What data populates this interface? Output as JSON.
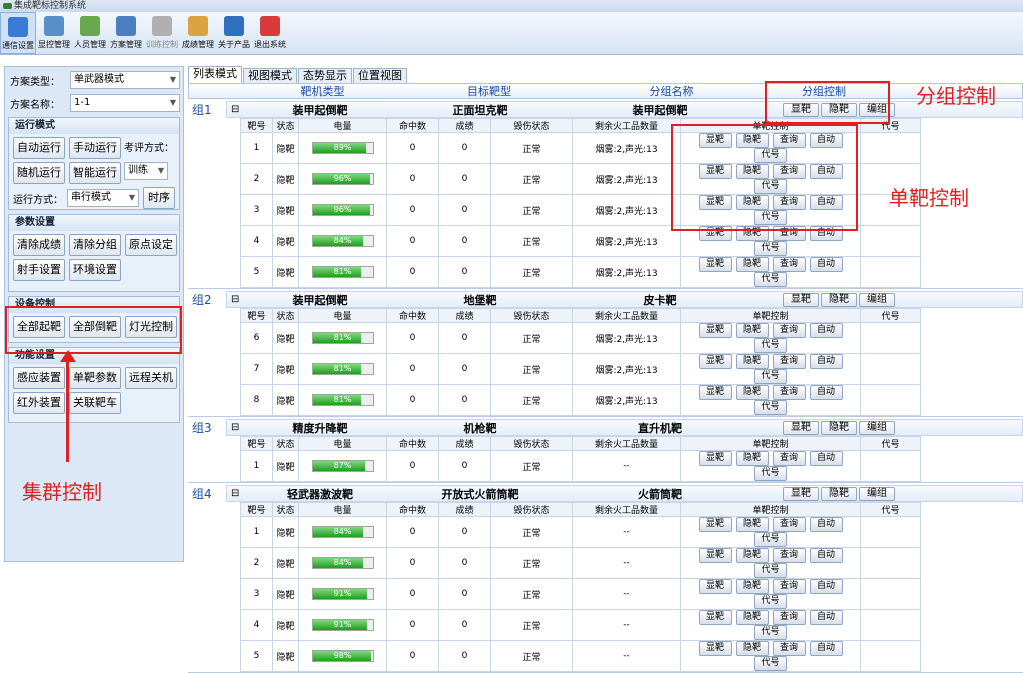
{
  "window_title": "集成靶标控制系统",
  "toolbar": [
    {
      "label": "通信设置",
      "color": "#3a7bd5",
      "active": true
    },
    {
      "label": "显控管理",
      "color": "#5b8fc9"
    },
    {
      "label": "人员管理",
      "color": "#6aa84f"
    },
    {
      "label": "方案管理",
      "color": "#4a7fc1"
    },
    {
      "label": "训练控制",
      "color": "#b0b0b0",
      "disabled": true
    },
    {
      "label": "成绩管理",
      "color": "#d9a441"
    },
    {
      "label": "关于产品",
      "color": "#2f6fbf"
    },
    {
      "label": "退出系统",
      "color": "#d93a3a"
    }
  ],
  "left": {
    "scheme_type_label": "方案类型：",
    "scheme_type_value": "单武器模式",
    "scheme_name_label": "方案名称：",
    "scheme_name_value": "1-1",
    "run_mode_title": "运行模式",
    "auto_run": "自动运行",
    "manual_run": "手动运行",
    "eval_mode_label": "考评方式：",
    "eval_mode_value": "训练",
    "random_run": "随机运行",
    "smart_run": "智能运行",
    "run_way_label": "运行方式：",
    "run_way_value": "串行模式",
    "timing": "时序",
    "param_title": "参数设置",
    "clear_scores": "清除成绩",
    "clear_groups": "清除分组",
    "origin_set": "原点设定",
    "shooter_set": "射手设置",
    "env_set": "环境设置",
    "device_title": "设备控制",
    "all_up": "全部起靶",
    "all_down": "全部倒靶",
    "light_ctrl": "灯光控制",
    "func_title": "功能设置",
    "sensor": "感应装置",
    "single_param": "单靶参数",
    "remote_off": "远程关机",
    "infrared": "红外装置",
    "link_car": "关联靶车"
  },
  "tabs": [
    "列表模式",
    "视图模式",
    "态势显示",
    "位置视图"
  ],
  "header": {
    "type": "靶机类型",
    "target": "目标靶型",
    "group_name": "分组名称",
    "group_ctrl": "分组控制"
  },
  "cols": [
    "靶号",
    "状态",
    "电量",
    "命中数",
    "成绩",
    "毁伤状态",
    "剩余火工品数量",
    "单靶控制",
    "代号"
  ],
  "ctrl_buttons": [
    "显靶",
    "隐靶",
    "查询",
    "自动",
    "代号"
  ],
  "group_buttons": [
    "显靶",
    "隐靶",
    "编组"
  ],
  "groups": [
    {
      "label": "组1",
      "names": [
        "装甲起倒靶",
        "正面坦克靶",
        "装甲起倒靶"
      ],
      "rows": [
        {
          "no": "1",
          "status": "隐靶",
          "battery": 89,
          "bat_text": "89%",
          "hits": "0",
          "score": "0",
          "damage": "正常",
          "remain": "烟雾:2,声光:13"
        },
        {
          "no": "2",
          "status": "隐靶",
          "battery": 96,
          "bat_text": "96%",
          "hits": "0",
          "score": "0",
          "damage": "正常",
          "remain": "烟雾:2,声光:13"
        },
        {
          "no": "3",
          "status": "隐靶",
          "battery": 96,
          "bat_text": "96%",
          "hits": "0",
          "score": "0",
          "damage": "正常",
          "remain": "烟雾:2,声光:13"
        },
        {
          "no": "4",
          "status": "隐靶",
          "battery": 84,
          "bat_text": "84%",
          "hits": "0",
          "score": "0",
          "damage": "正常",
          "remain": "烟雾:2,声光:13"
        },
        {
          "no": "5",
          "status": "隐靶",
          "battery": 81,
          "bat_text": "81%",
          "hits": "0",
          "score": "0",
          "damage": "正常",
          "remain": "烟雾:2,声光:13"
        }
      ]
    },
    {
      "label": "组2",
      "names": [
        "装甲起倒靶",
        "地堡靶",
        "皮卡靶"
      ],
      "rows": [
        {
          "no": "6",
          "status": "隐靶",
          "battery": 81,
          "bat_text": "81%",
          "hits": "0",
          "score": "0",
          "damage": "正常",
          "remain": "烟雾:2,声光:13"
        },
        {
          "no": "7",
          "status": "隐靶",
          "battery": 81,
          "bat_text": "81%",
          "hits": "0",
          "score": "0",
          "damage": "正常",
          "remain": "烟雾:2,声光:13"
        },
        {
          "no": "8",
          "status": "隐靶",
          "battery": 81,
          "bat_text": "81%",
          "hits": "0",
          "score": "0",
          "damage": "正常",
          "remain": "烟雾:2,声光:13"
        }
      ]
    },
    {
      "label": "组3",
      "names": [
        "精度升降靶",
        "机枪靶",
        "直升机靶"
      ],
      "rows": [
        {
          "no": "1",
          "status": "隐靶",
          "battery": 87,
          "bat_text": "87%",
          "hits": "0",
          "score": "0",
          "damage": "正常",
          "remain": "--"
        }
      ]
    },
    {
      "label": "组4",
      "names": [
        "轻武器激波靶",
        "开放式火箭筒靶",
        "火箭筒靶"
      ],
      "rows": [
        {
          "no": "1",
          "status": "隐靶",
          "battery": 84,
          "bat_text": "84%",
          "hits": "0",
          "score": "0",
          "damage": "正常",
          "remain": "--"
        },
        {
          "no": "2",
          "status": "隐靶",
          "battery": 84,
          "bat_text": "84%",
          "hits": "0",
          "score": "0",
          "damage": "正常",
          "remain": "--"
        },
        {
          "no": "3",
          "status": "隐靶",
          "battery": 91,
          "bat_text": "91%",
          "hits": "0",
          "score": "0",
          "damage": "正常",
          "remain": "--"
        },
        {
          "no": "4",
          "status": "隐靶",
          "battery": 91,
          "bat_text": "91%",
          "hits": "0",
          "score": "0",
          "damage": "正常",
          "remain": "--"
        },
        {
          "no": "5",
          "status": "隐靶",
          "battery": 98,
          "bat_text": "98%",
          "hits": "0",
          "score": "0",
          "damage": "正常",
          "remain": "--"
        }
      ]
    }
  ],
  "annotations": {
    "group_ctrl": "分组控制",
    "single_ctrl": "单靶控制",
    "cluster_ctrl": "集群控制"
  }
}
